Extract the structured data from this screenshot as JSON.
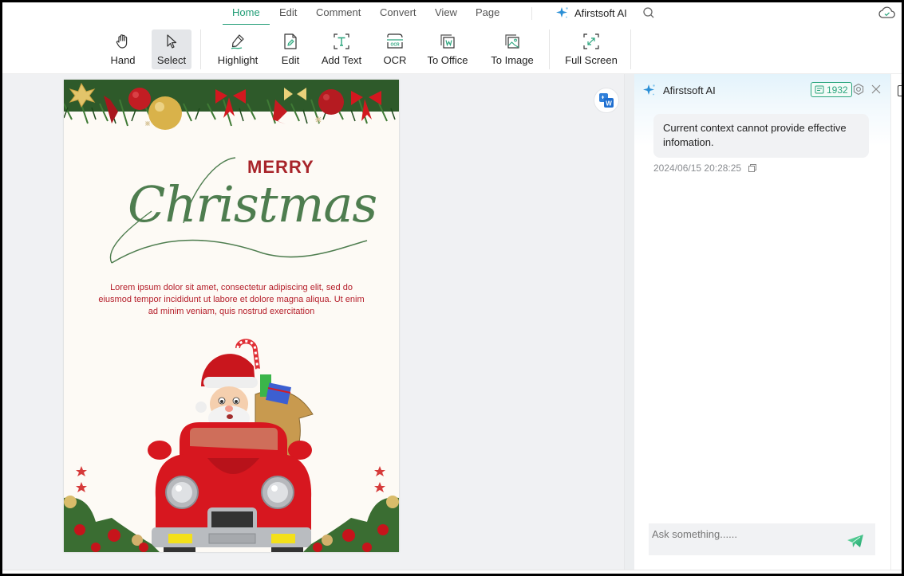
{
  "menu": {
    "tabs": [
      {
        "label": "Home",
        "active": true
      },
      {
        "label": "Edit",
        "active": false
      },
      {
        "label": "Comment",
        "active": false
      },
      {
        "label": "Convert",
        "active": false
      },
      {
        "label": "View",
        "active": false
      },
      {
        "label": "Page",
        "active": false
      }
    ],
    "ai_label": "Afirstsoft AI",
    "icons": {
      "ai": "sparkle-icon",
      "search": "search-icon",
      "cloud": "cloud-sync-icon"
    }
  },
  "toolbar": {
    "tools": [
      {
        "label": "Hand",
        "icon": "hand-icon",
        "active": false
      },
      {
        "label": "Select",
        "icon": "cursor-arrow-icon",
        "active": true
      },
      {
        "label": "Highlight",
        "icon": "highlighter-pen-icon",
        "active": false
      },
      {
        "label": "Edit",
        "icon": "edit-document-icon",
        "active": false
      },
      {
        "label": "Add Text",
        "icon": "add-text-icon",
        "active": false
      },
      {
        "label": "OCR",
        "icon": "ocr-icon",
        "active": false
      },
      {
        "label": "To Office",
        "icon": "to-word-icon",
        "active": false
      },
      {
        "label": "To Image",
        "icon": "to-image-icon",
        "active": false
      },
      {
        "label": "Full Screen",
        "icon": "full-screen-icon",
        "active": false
      }
    ]
  },
  "document": {
    "heading_small": "MERRY",
    "heading_script": "Christmas",
    "body_text": "Lorem ipsum dolor sit amet, consectetur adipiscing elit, sed do eiusmod tempor incididunt ut labore et dolore magna aliqua. Ut enim ad minim veniam, quis nostrud exercitation",
    "colors": {
      "merry": "#a8242a",
      "script": "#4e7d4f",
      "body": "#b51e2a",
      "paper": "#fdfaf5"
    },
    "illustrations": [
      "christmas-garland-image",
      "santa-in-red-car-image",
      "holly-corner-decor-image"
    ]
  },
  "translate_button": {
    "icon": "translate-to-word-icon"
  },
  "ai_panel": {
    "title": "Afirstsoft AI",
    "token_count": "1932",
    "messages": [
      {
        "text": "Current context cannot provide effective infomation.",
        "timestamp": "2024/06/15 20:28:25"
      }
    ],
    "input": {
      "placeholder": "Ask something......",
      "value": ""
    },
    "accent": "#2aa57d"
  }
}
